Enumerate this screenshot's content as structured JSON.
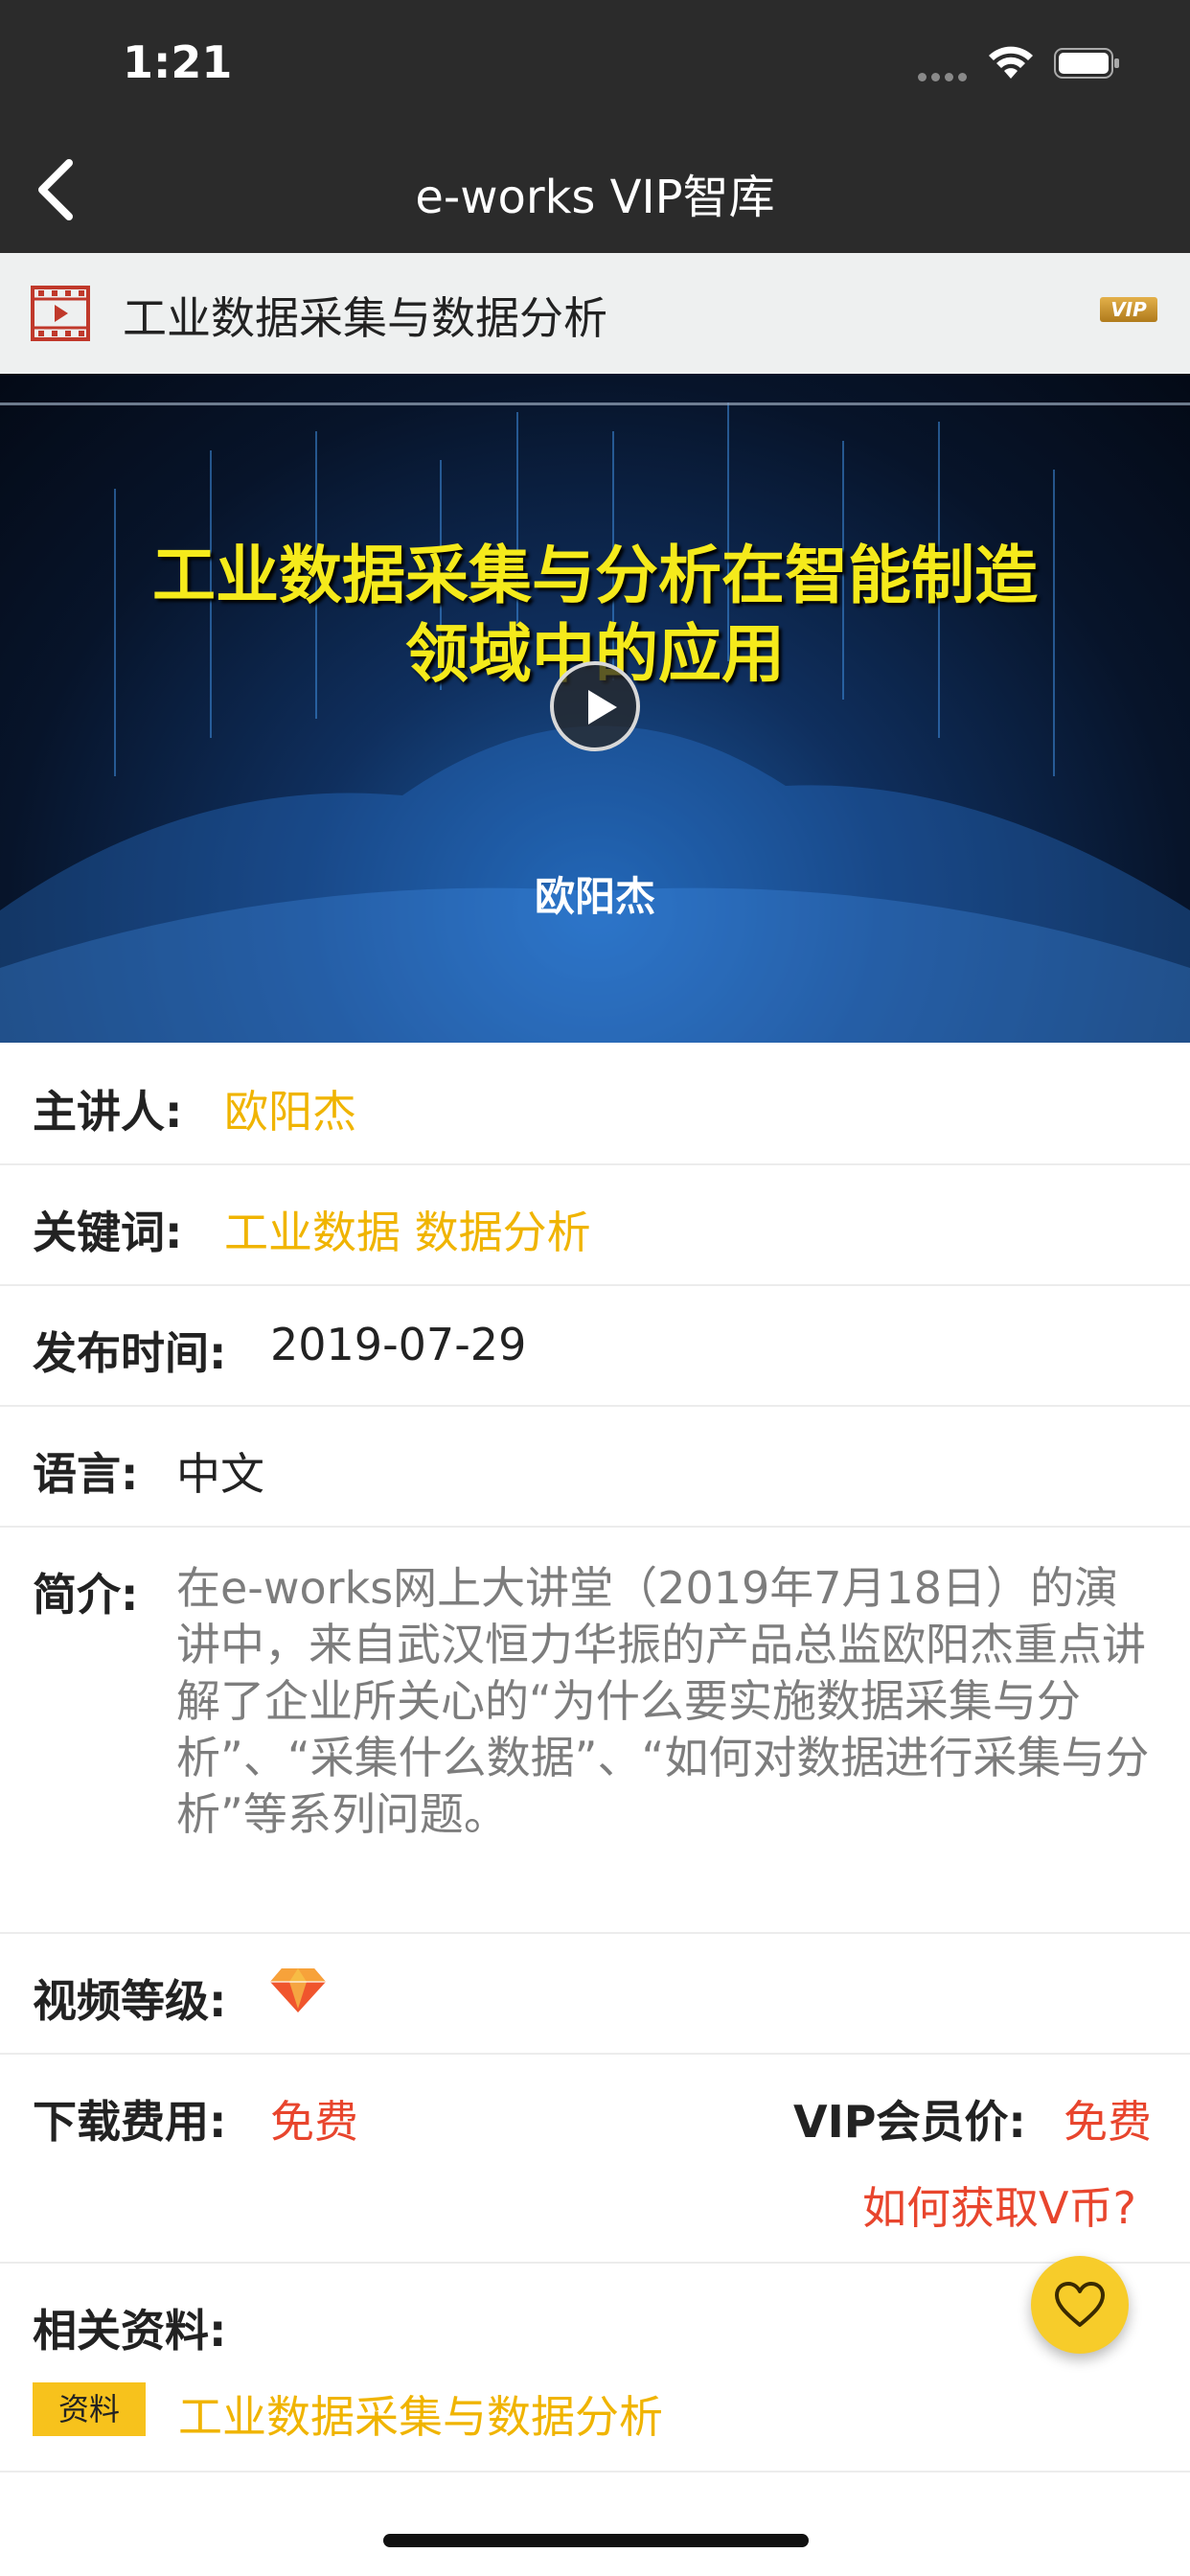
{
  "status_bar": {
    "time": "1:21"
  },
  "nav": {
    "title": "e-works VIP智库"
  },
  "course": {
    "title": "工业数据采集与数据分析",
    "vip_badge": "VIP"
  },
  "video": {
    "headline_line1": "工业数据采集与分析在智能制造",
    "headline_line2": "领域中的应用",
    "speaker": "欧阳杰"
  },
  "details": {
    "speaker_label": "主讲人:",
    "speaker_value": "欧阳杰",
    "keywords_label": "关键词:",
    "keywords_value": "工业数据 数据分析",
    "date_label": "发布时间:",
    "date_value": "2019-07-29",
    "language_label": "语言:",
    "language_value": "中文",
    "intro_label": "简介:",
    "intro_value": "在e-works网上大讲堂（2019年7月18日）的演讲中，来自武汉恒力华振的产品总监欧阳杰重点讲解了企业所关心的“为什么要实施数据采集与分析”、“采集什么数据”、“如何对数据进行采集与分析”等系列问题。",
    "level_label": "视频等级:",
    "level_icon": "diamond-icon"
  },
  "pricing": {
    "download_label": "下载费用:",
    "download_value": "免费",
    "vip_label": "VIP会员价:",
    "vip_value": "免费",
    "vcoin_link": "如何获取V币?"
  },
  "related": {
    "label": "相关资料:",
    "tag": "资料",
    "item": "工业数据采集与数据分析"
  },
  "colors": {
    "accent_gold": "#f0b400",
    "price_red": "#e8452d",
    "nav_bg": "#2b2b2b"
  }
}
